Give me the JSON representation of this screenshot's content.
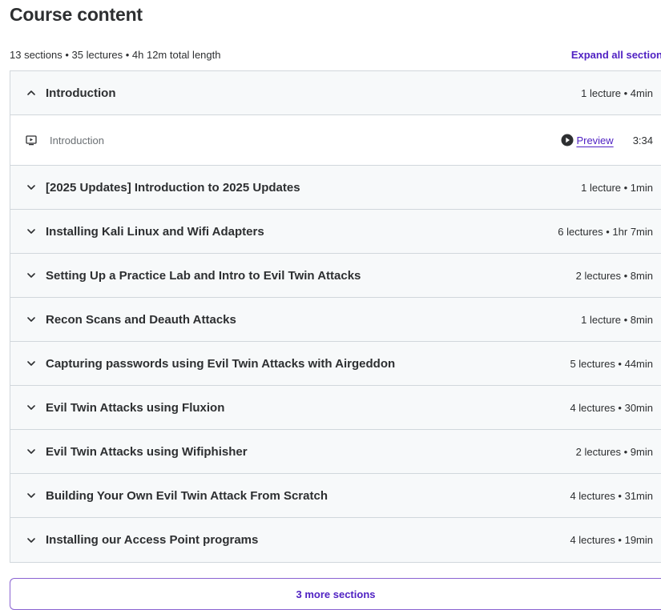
{
  "header": {
    "title": "Course content",
    "summary": "13 sections • 35 lectures • 4h 12m total length",
    "expand_all": "Expand all section"
  },
  "sections": [
    {
      "title": "Introduction",
      "meta": "1 lecture • 4min",
      "expanded": true,
      "lectures": [
        {
          "title": "Introduction",
          "preview": "Preview",
          "duration": "3:34"
        }
      ]
    },
    {
      "title": "[2025 Updates] Introduction to 2025 Updates",
      "meta": "1 lecture • 1min",
      "expanded": false
    },
    {
      "title": "Installing Kali Linux and Wifi Adapters",
      "meta": "6 lectures • 1hr 7min",
      "expanded": false
    },
    {
      "title": "Setting Up a Practice Lab and Intro to Evil Twin Attacks",
      "meta": "2 lectures • 8min",
      "expanded": false
    },
    {
      "title": "Recon Scans and Deauth Attacks",
      "meta": "1 lecture • 8min",
      "expanded": false
    },
    {
      "title": "Capturing passwords using Evil Twin Attacks with Airgeddon",
      "meta": "5 lectures • 44min",
      "expanded": false
    },
    {
      "title": "Evil Twin Attacks using Fluxion",
      "meta": "4 lectures • 30min",
      "expanded": false
    },
    {
      "title": "Evil Twin Attacks using Wifiphisher",
      "meta": "2 lectures • 9min",
      "expanded": false
    },
    {
      "title": "Building Your Own Evil Twin Attack From Scratch",
      "meta": "4 lectures • 31min",
      "expanded": false
    },
    {
      "title": "Installing our Access Point programs",
      "meta": "4 lectures • 19min",
      "expanded": false
    }
  ],
  "more_sections": "3 more sections",
  "icons": {
    "expanded": "chevron-up-icon",
    "collapsed": "chevron-down-icon",
    "lecture": "video-lecture-icon",
    "preview": "play-circle-icon"
  },
  "colors": {
    "accent": "#5022c3",
    "border": "#d1d7dc",
    "header_bg": "#f7f9fa",
    "text": "#2d2f31"
  }
}
